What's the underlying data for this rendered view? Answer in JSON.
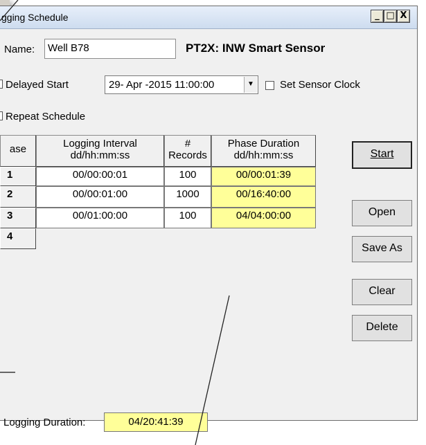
{
  "window": {
    "title": "gging Schedule",
    "buttons": {
      "minimize": "_",
      "maximize": "□",
      "close": "X"
    }
  },
  "form": {
    "name_label": "Name:",
    "name_value": "Well B78",
    "device_label": "PT2X: INW Smart Sensor",
    "delayed_start_label": "Delayed Start",
    "delayed_start_value": "29- Apr -2015  11:00:00",
    "set_clock_label": "Set Sensor Clock",
    "set_clock_checked": false,
    "repeat_schedule_label": "Repeat Schedule",
    "logging_duration_label": "Logging Duration:",
    "logging_duration_value": "04/20:41:39"
  },
  "grid": {
    "headers": {
      "phase": "ase",
      "interval_line1": "Logging Interval",
      "interval_line2": "dd/hh:mm:ss",
      "records_line1": "#",
      "records_line2": "Records",
      "duration_line1": "Phase Duration",
      "duration_line2": "dd/hh:mm:ss"
    },
    "rows": [
      {
        "phase": "1",
        "interval": "00/00:00:01",
        "records": "100",
        "duration": "00/00:01:39"
      },
      {
        "phase": "2",
        "interval": "00/00:01:00",
        "records": "1000",
        "duration": "00/16:40:00"
      },
      {
        "phase": "3",
        "interval": "00/01:00:00",
        "records": "100",
        "duration": "04/04:00:00"
      },
      {
        "phase": "4",
        "interval": "",
        "records": "",
        "duration": ""
      }
    ]
  },
  "actions": {
    "start": "Start",
    "open": "Open",
    "save_as": "Save As",
    "clear": "Clear",
    "delete": "Delete"
  },
  "colors": {
    "highlight": "#ffff99",
    "title_bar": "#dbe6f4",
    "dialog_bg": "#f0f0f0"
  }
}
